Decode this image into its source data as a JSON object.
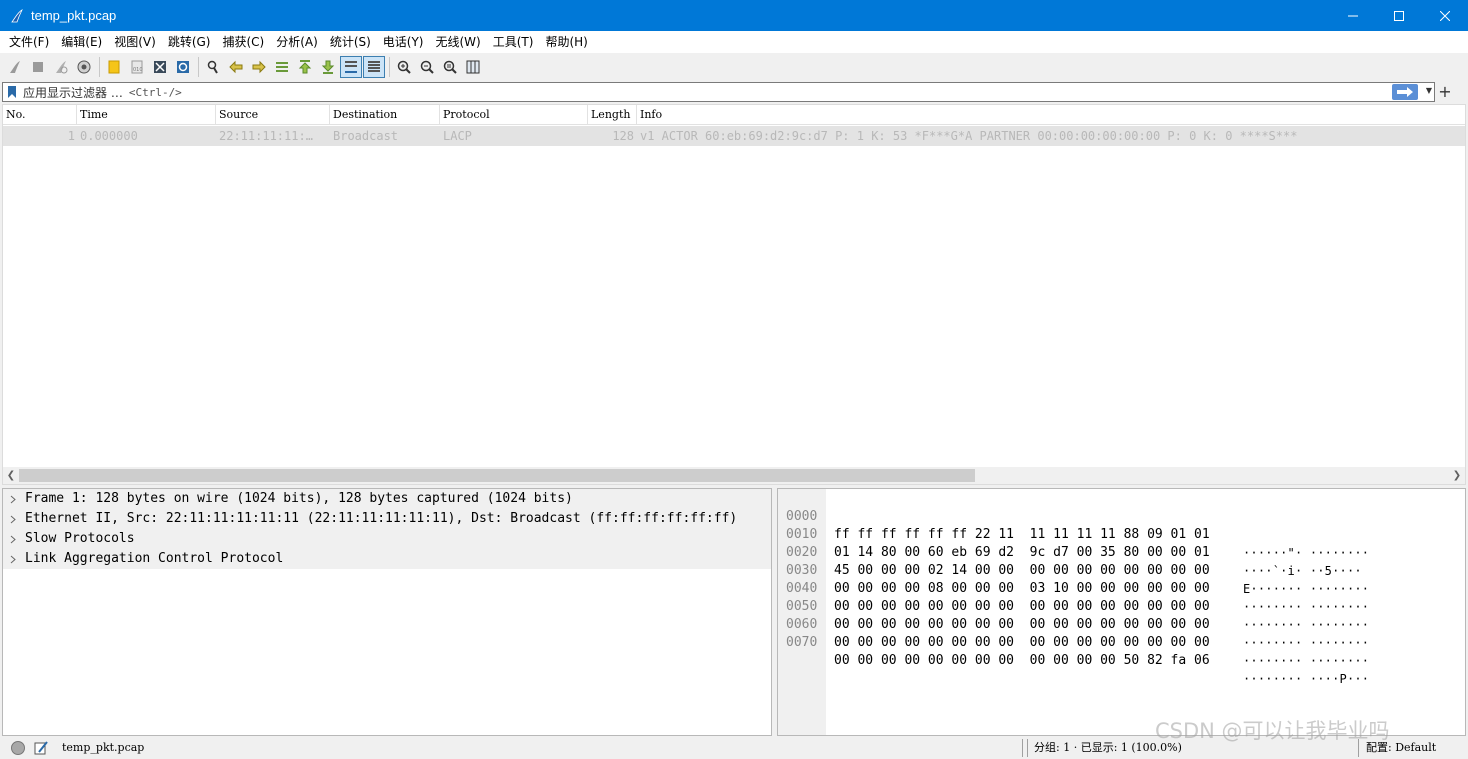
{
  "window": {
    "title": "temp_pkt.pcap",
    "minimize_icon": "minimize-icon",
    "maximize_icon": "maximize-icon",
    "close_icon": "close-icon"
  },
  "menu": [
    "文件(F)",
    "编辑(E)",
    "视图(V)",
    "跳转(G)",
    "捕获(C)",
    "分析(A)",
    "统计(S)",
    "电话(Y)",
    "无线(W)",
    "工具(T)",
    "帮助(H)"
  ],
  "toolbar": {
    "icons": [
      "start-capture-icon",
      "stop-capture-icon",
      "restart-capture-icon",
      "capture-options-icon",
      "open-file-icon",
      "save-file-icon",
      "close-file-icon",
      "reload-file-icon",
      "find-packet-icon",
      "go-back-icon",
      "go-forward-icon",
      "go-to-packet-icon",
      "go-first-icon",
      "go-last-icon",
      "auto-scroll-icon",
      "colorize-icon",
      "zoom-in-icon",
      "zoom-out-icon",
      "normal-size-icon",
      "resize-columns-icon"
    ]
  },
  "filter": {
    "label": "应用显示过滤器 …",
    "hint": "<Ctrl-/>",
    "plus": "+"
  },
  "packet_list": {
    "columns": [
      "No.",
      "Time",
      "Source",
      "Destination",
      "Protocol",
      "Length",
      "Info"
    ],
    "rows": [
      {
        "no": "1",
        "time": "0.000000",
        "source": "22:11:11:11:…",
        "destination": "Broadcast",
        "protocol": "LACP",
        "length": "128",
        "info": "v1 ACTOR 60:eb:69:d2:9c:d7 P: 1 K: 53 *F***G*A PARTNER 00:00:00:00:00:00 P: 0 K: 0 ****S***"
      }
    ]
  },
  "details": [
    "Frame 1: 128 bytes on wire (1024 bits), 128 bytes captured (1024 bits)",
    "Ethernet II, Src: 22:11:11:11:11:11 (22:11:11:11:11:11), Dst: Broadcast (ff:ff:ff:ff:ff:ff)",
    "Slow Protocols",
    "Link Aggregation Control Protocol"
  ],
  "bytes": [
    {
      "offset": "0000",
      "hex": "ff ff ff ff ff ff 22 11  11 11 11 11 88 09 01 01",
      "ascii": "······\"· ········"
    },
    {
      "offset": "0010",
      "hex": "01 14 80 00 60 eb 69 d2  9c d7 00 35 80 00 00 01",
      "ascii": "····`·i· ··5····"
    },
    {
      "offset": "0020",
      "hex": "45 00 00 00 02 14 00 00  00 00 00 00 00 00 00 00",
      "ascii": "E······· ········"
    },
    {
      "offset": "0030",
      "hex": "00 00 00 00 08 00 00 00  03 10 00 00 00 00 00 00",
      "ascii": "········ ········"
    },
    {
      "offset": "0040",
      "hex": "00 00 00 00 00 00 00 00  00 00 00 00 00 00 00 00",
      "ascii": "········ ········"
    },
    {
      "offset": "0050",
      "hex": "00 00 00 00 00 00 00 00  00 00 00 00 00 00 00 00",
      "ascii": "········ ········"
    },
    {
      "offset": "0060",
      "hex": "00 00 00 00 00 00 00 00  00 00 00 00 00 00 00 00",
      "ascii": "········ ········"
    },
    {
      "offset": "0070",
      "hex": "00 00 00 00 00 00 00 00  00 00 00 00 50 82 fa 06",
      "ascii": "········ ····P···"
    }
  ],
  "status": {
    "file": "temp_pkt.pcap",
    "packets": "分组: 1 · 已显示: 1 (100.0%)",
    "profile": "配置: Default"
  },
  "watermark": "CSDN @可以让我毕业吗",
  "colors": {
    "titlebar": "#0078d7",
    "row_bg": "#e3e3e3",
    "row_text": "#b8b8b8"
  }
}
